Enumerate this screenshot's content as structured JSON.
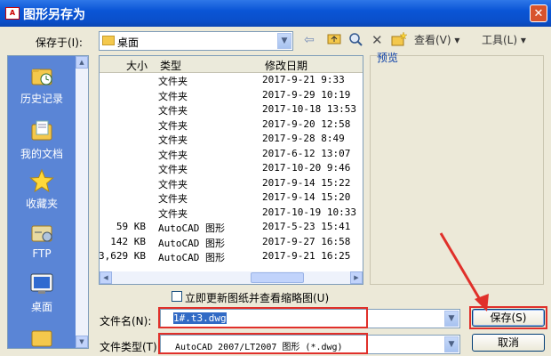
{
  "window": {
    "title": "图形另存为",
    "app_icon": "autocad-icon",
    "close": "✕"
  },
  "save_in": {
    "label": "保存于(I):",
    "value": "桌面",
    "icon": "desktop-folder-icon"
  },
  "toolbar": {
    "view_label": "查看(V)",
    "tools_label": "工具(L)"
  },
  "places": [
    {
      "label": "历史记录",
      "icon": "history-icon"
    },
    {
      "label": "我的文档",
      "icon": "my-documents-icon"
    },
    {
      "label": "收藏夹",
      "icon": "favorites-icon"
    },
    {
      "label": "FTP",
      "icon": "ftp-icon"
    },
    {
      "label": "桌面",
      "icon": "desktop-icon"
    }
  ],
  "columns": {
    "size": "大小",
    "type": "类型",
    "modified": "修改日期"
  },
  "files": [
    {
      "size": "",
      "type": "文件夹",
      "date": "2017-9-21 9:33"
    },
    {
      "size": "",
      "type": "文件夹",
      "date": "2017-9-29 10:19"
    },
    {
      "size": "",
      "type": "文件夹",
      "date": "2017-10-18 13:53"
    },
    {
      "size": "",
      "type": "文件夹",
      "date": "2017-9-20 12:58"
    },
    {
      "size": "",
      "type": "文件夹",
      "date": "2017-9-28 8:49"
    },
    {
      "size": "",
      "type": "文件夹",
      "date": "2017-6-12 13:07"
    },
    {
      "size": "",
      "type": "文件夹",
      "date": "2017-10-20 9:46"
    },
    {
      "size": "",
      "type": "文件夹",
      "date": "2017-9-14 15:22"
    },
    {
      "size": "",
      "type": "文件夹",
      "date": "2017-9-14 15:20"
    },
    {
      "size": "",
      "type": "文件夹",
      "date": "2017-10-19 10:33"
    },
    {
      "size": "59 KB",
      "type": "AutoCAD 图形",
      "date": "2017-5-23 15:41"
    },
    {
      "size": "142 KB",
      "type": "AutoCAD 图形",
      "date": "2017-9-27 16:58"
    },
    {
      "size": "3,629 KB",
      "type": "AutoCAD 图形",
      "date": "2017-9-21 16:25"
    }
  ],
  "preview": {
    "label": "预览"
  },
  "update_thumbnail": {
    "label": "立即更新图纸并查看缩略图(U)",
    "checked": false
  },
  "filename": {
    "label": "文件名(N):",
    "value": "1#.t3.dwg"
  },
  "filetype": {
    "label": "文件类型(T):",
    "value": "AutoCAD 2007/LT2007 图形 (*.dwg)"
  },
  "buttons": {
    "save": "保存(S)",
    "cancel": "取消"
  },
  "annotation_color": "#e0302a"
}
